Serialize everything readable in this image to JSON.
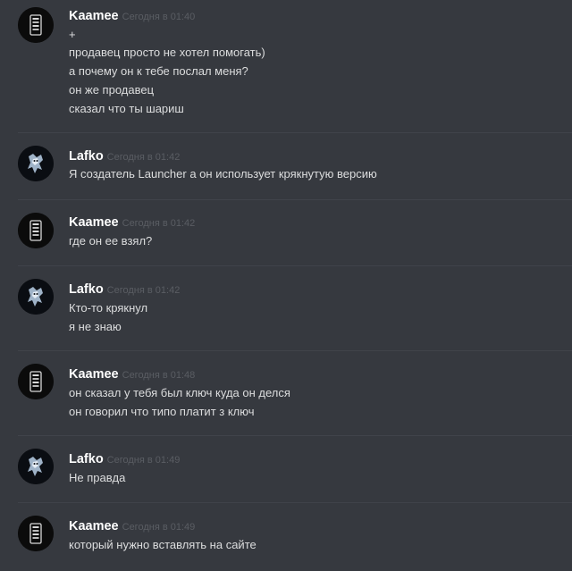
{
  "messages": [
    {
      "author": "Kaamee",
      "time": "Сегодня в 01:40",
      "lines": [
        "+",
        "продавец просто не хотел помогать)",
        "а почему он к тебе послал меня?",
        "он же продавец",
        "сказал что ты шариш"
      ]
    },
    {
      "author": "Lafko",
      "time": "Сегодня в 01:42",
      "lines": [
        "Я создатель Launcher а он использует крякнутую версию"
      ]
    },
    {
      "author": "Kaamee",
      "time": "Сегодня в 01:42",
      "lines": [
        "где он ее взял?"
      ]
    },
    {
      "author": "Lafko",
      "time": "Сегодня в 01:42",
      "lines": [
        "Кто-то крякнул",
        "я не знаю"
      ]
    },
    {
      "author": "Kaamee",
      "time": "Сегодня в 01:48",
      "lines": [
        "он сказал у тебя был ключ куда он делся",
        "он говорил что типо платит з ключ"
      ]
    },
    {
      "author": "Lafko",
      "time": "Сегодня в 01:49",
      "lines": [
        "Не правда"
      ]
    },
    {
      "author": "Kaamee",
      "time": "Сегодня в 01:49",
      "lines": [
        "который нужно вставлять на сайте"
      ]
    }
  ]
}
